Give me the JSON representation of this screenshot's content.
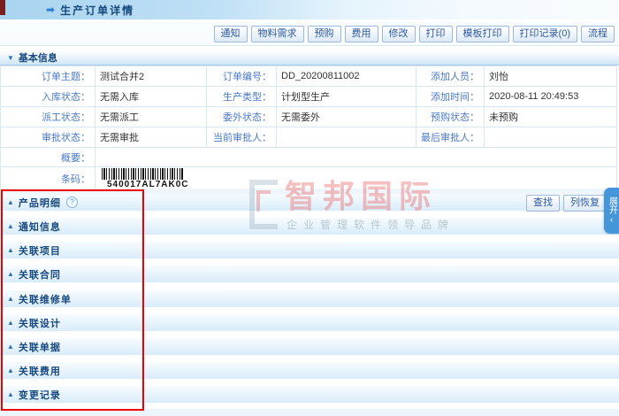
{
  "header": {
    "title": "生产订单详情"
  },
  "toolbar": {
    "buttons": [
      "通知",
      "物料需求",
      "预购",
      "费用",
      "修改",
      "打印",
      "模板打印",
      "打印记录(0)",
      "流程"
    ]
  },
  "basic_info": {
    "title": "基本信息",
    "rows": [
      [
        {
          "label": "订单主题：",
          "value": "测试合并2"
        },
        {
          "label": "订单编号：",
          "value": "DD_20200811002"
        },
        {
          "label": "添加人员：",
          "value": "刘怡"
        }
      ],
      [
        {
          "label": "入库状态：",
          "value": "无需入库"
        },
        {
          "label": "生产类型：",
          "value": "计划型生产"
        },
        {
          "label": "添加时间：",
          "value": "2020-08-11 20:49:53"
        }
      ],
      [
        {
          "label": "派工状态：",
          "value": "无需派工"
        },
        {
          "label": "委外状态：",
          "value": "无需委外"
        },
        {
          "label": "预购状态：",
          "value": "未预购"
        }
      ],
      [
        {
          "label": "审批状态：",
          "value": "无需审批"
        },
        {
          "label": "当前审批人：",
          "value": ""
        },
        {
          "label": "最后审批人：",
          "value": ""
        }
      ]
    ],
    "summary": {
      "label": "概要：",
      "value": ""
    },
    "barcode": {
      "label": "条码：",
      "value": "540017AL7AK0C"
    }
  },
  "product_tools": {
    "help": "?",
    "find_button": "查找",
    "restore_button": "列恢复"
  },
  "sections": [
    {
      "label": "产品明细"
    },
    {
      "label": "通知信息"
    },
    {
      "label": "关联项目"
    },
    {
      "label": "关联合同"
    },
    {
      "label": "关联维修单"
    },
    {
      "label": "关联设计"
    },
    {
      "label": "关联单据"
    },
    {
      "label": "关联费用"
    },
    {
      "label": "变更记录"
    }
  ],
  "expand_tab": {
    "label": "展开",
    "chevron": "‹"
  },
  "watermark": {
    "brand": "智邦国际",
    "slogan": "企业管理软件领导品牌"
  },
  "colors": {
    "accent": "#17497f",
    "annotation_red": "#ee0000",
    "flap_blue": "#4596d8"
  }
}
